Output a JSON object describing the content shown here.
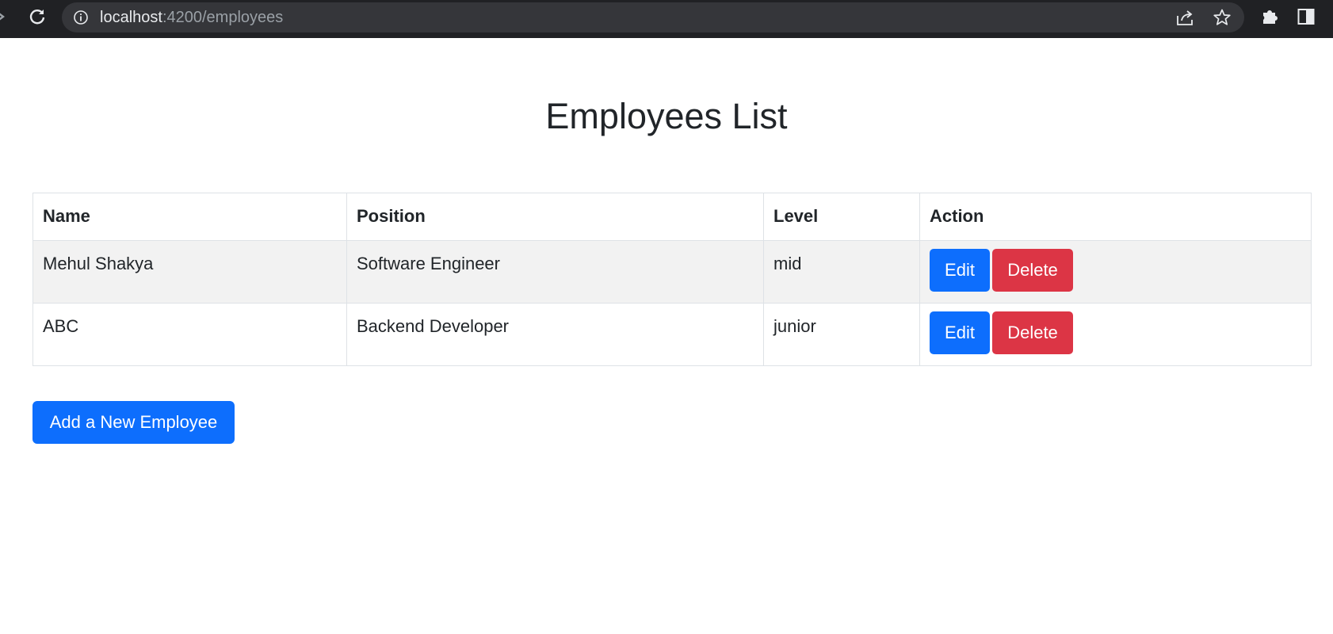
{
  "browser": {
    "url_host": "localhost",
    "url_rest": ":4200/employees"
  },
  "page": {
    "title": "Employees List"
  },
  "table": {
    "headers": [
      "Name",
      "Position",
      "Level",
      "Action"
    ],
    "rows": [
      {
        "name": "Mehul Shakya",
        "position": "Software Engineer",
        "level": "mid",
        "edit_label": "Edit",
        "delete_label": "Delete"
      },
      {
        "name": "ABC",
        "position": "Backend Developer",
        "level": "junior",
        "edit_label": "Edit",
        "delete_label": "Delete"
      }
    ]
  },
  "add_button": {
    "label": "Add a New Employee"
  },
  "colors": {
    "primary": "#0d6efd",
    "danger": "#dc3545",
    "toolbar": "#202124"
  },
  "icons": [
    "forward-icon",
    "reload-icon",
    "info-icon",
    "share-icon",
    "star-icon",
    "extensions-icon",
    "side-panel-icon"
  ]
}
